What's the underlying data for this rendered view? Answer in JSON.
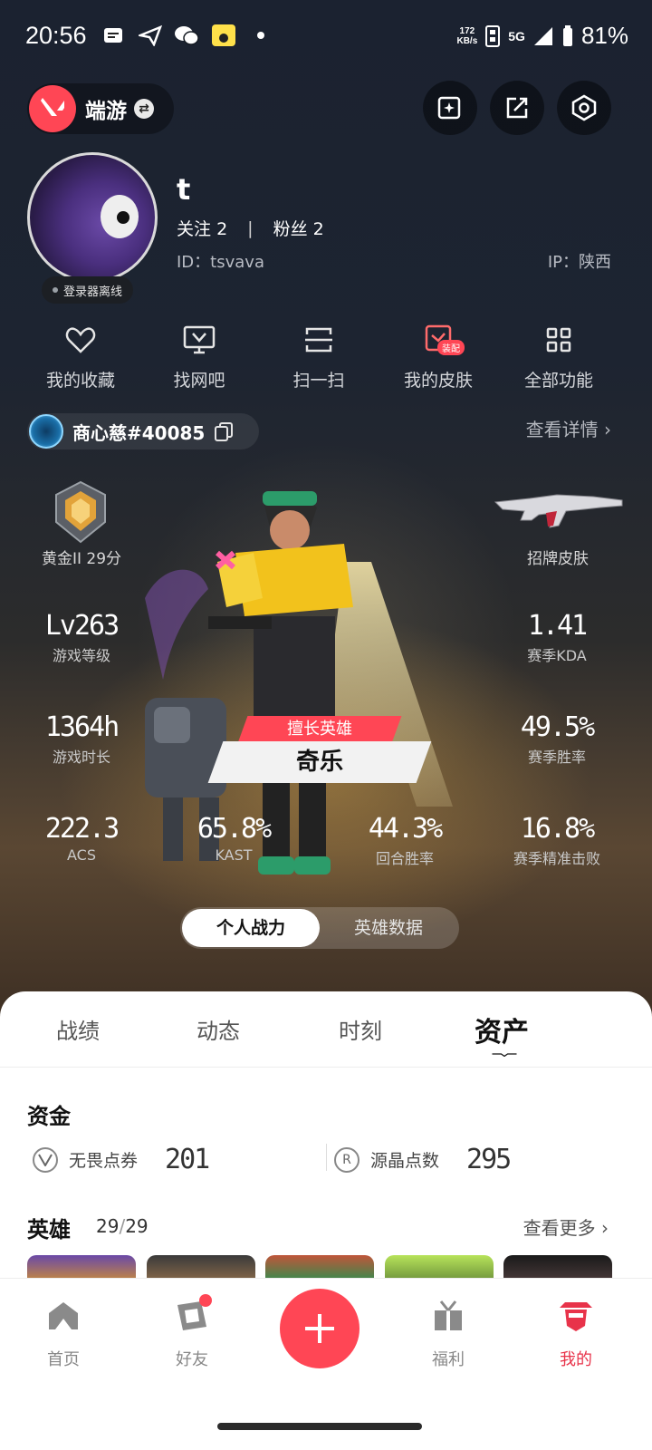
{
  "status_bar": {
    "time": "20:56",
    "net_speed_value": "172",
    "net_speed_unit": "KB/s",
    "network": "5G",
    "battery": "81%"
  },
  "header": {
    "game_name": "端游"
  },
  "profile": {
    "username": "t",
    "following_label": "关注",
    "following_count": "2",
    "fans_label": "粉丝",
    "fans_count": "2",
    "id_text": "ID：tsvava",
    "ip_text": "IP：陕西",
    "online_status": "登录器离线"
  },
  "quick_menu": {
    "favorites": "我的收藏",
    "find_cafe": "找网吧",
    "scan": "扫一扫",
    "skins": "我的皮肤",
    "skins_badge": "装配",
    "all_functions": "全部功能"
  },
  "riot": {
    "name": "商心慈#40085",
    "detail_link": "查看详情"
  },
  "rank": {
    "label": "黄金II 29分",
    "skin_label": "招牌皮肤"
  },
  "stats": {
    "level_value": "Lv263",
    "level_label": "游戏等级",
    "kda_value": "1.41",
    "kda_label": "赛季KDA",
    "hours_value": "1364h",
    "hours_label": "游戏时长",
    "winrate_value": "49.5%",
    "winrate_label": "赛季胜率",
    "acs_value": "222.3",
    "acs_label": "ACS",
    "kast_value": "65.8%",
    "kast_label": "KAST",
    "round_win_value": "44.3%",
    "round_win_label": "回合胜率",
    "hs_value": "16.8%",
    "hs_label": "赛季精准击败"
  },
  "main_agent": {
    "tag": "擅长英雄",
    "name": "奇乐"
  },
  "toggle": {
    "active": "个人战力",
    "inactive": "英雄数据"
  },
  "tabs": [
    "战绩",
    "动态",
    "时刻",
    "资产"
  ],
  "assets": {
    "funds_title": "资金",
    "vp_label": "无畏点券",
    "vp_value": "201",
    "rp_label": "源晶点数",
    "rp_value": "295",
    "heroes_title": "英雄",
    "heroes_owned": "29",
    "heroes_sep": "/",
    "heroes_total": "29",
    "more_link": "查看更多"
  },
  "bottom_nav": {
    "home": "首页",
    "friends": "好友",
    "welfare": "福利",
    "mine": "我的"
  },
  "colors": {
    "accent": "#ff4655",
    "active_nav": "#e8334a"
  }
}
